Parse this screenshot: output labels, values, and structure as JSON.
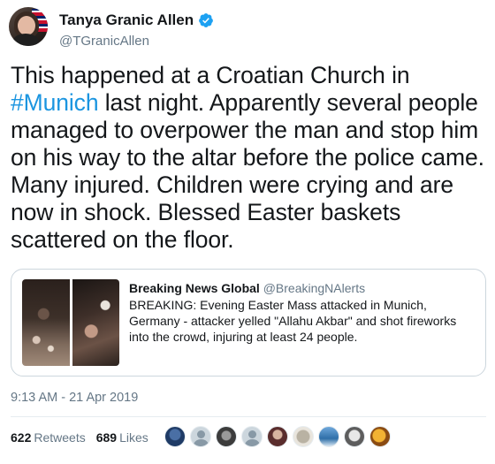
{
  "author": {
    "display_name": "Tanya Granic Allen",
    "handle": "@TGranicAllen",
    "verified": true
  },
  "tweet": {
    "text_before": "This happened at a Croatian Church in ",
    "hashtag": "#Munich",
    "text_after": " last night. Apparently several people managed to overpower the man and stop him on his way to the altar before the police came. Many injured. Children were crying and are now in shock. Blessed Easter baskets scattered on the floor."
  },
  "quoted_tweet": {
    "display_name": "Breaking News Global",
    "handle": "@BreakingNAlerts",
    "text": "BREAKING: Evening Easter Mass attacked in Munich, Germany - attacker yelled \"Allahu Akbar\" and shot fireworks into the crowd, injuring at least 24 people."
  },
  "timestamp": "9:13 AM - 21 Apr 2019",
  "stats": {
    "retweets_count": "622",
    "retweets_label": "Retweets",
    "likes_count": "689",
    "likes_label": "Likes"
  },
  "colors": {
    "link": "#1b95e0",
    "secondary_text": "#657786",
    "verified_badge": "#1da1f2"
  }
}
